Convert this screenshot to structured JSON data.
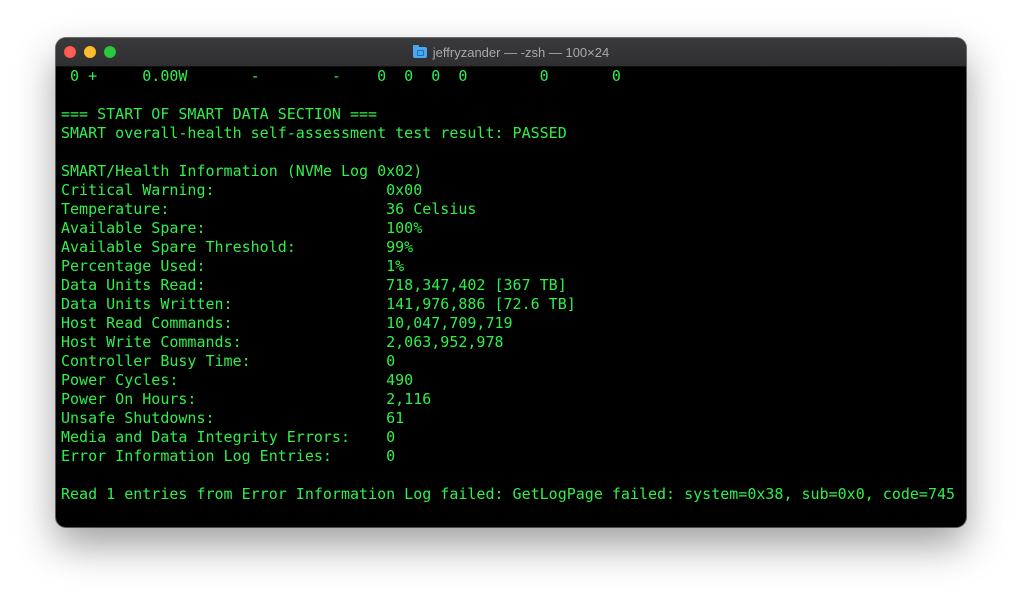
{
  "window": {
    "title": "jeffryzander — -zsh — 100×24",
    "title_icon": "folder-icon",
    "colors": {
      "background": "#000000",
      "text": "#2ff04a",
      "close": "#ff5f57",
      "minimize": "#febc2e",
      "maximize": "#28c840"
    }
  },
  "terminal": {
    "lines": [
      " 0 +     0.00W       -        -    0  0  0  0        0       0",
      "",
      "=== START OF SMART DATA SECTION ===",
      "SMART overall-health self-assessment test result: PASSED",
      "",
      "SMART/Health Information (NVMe Log 0x02)",
      "Critical Warning:                   0x00",
      "Temperature:                        36 Celsius",
      "Available Spare:                    100%",
      "Available Spare Threshold:          99%",
      "Percentage Used:                    1%",
      "Data Units Read:                    718,347,402 [367 TB]",
      "Data Units Written:                 141,976,886 [72.6 TB]",
      "Host Read Commands:                 10,047,709,719",
      "Host Write Commands:                2,063,952,978",
      "Controller Busy Time:               0",
      "Power Cycles:                       490",
      "Power On Hours:                     2,116",
      "Unsafe Shutdowns:                   61",
      "Media and Data Integrity Errors:    0",
      "Error Information Log Entries:      0",
      "",
      "Read 1 entries from Error Information Log failed: GetLogPage failed: system=0x38, sub=0x0, code=745"
    ]
  }
}
